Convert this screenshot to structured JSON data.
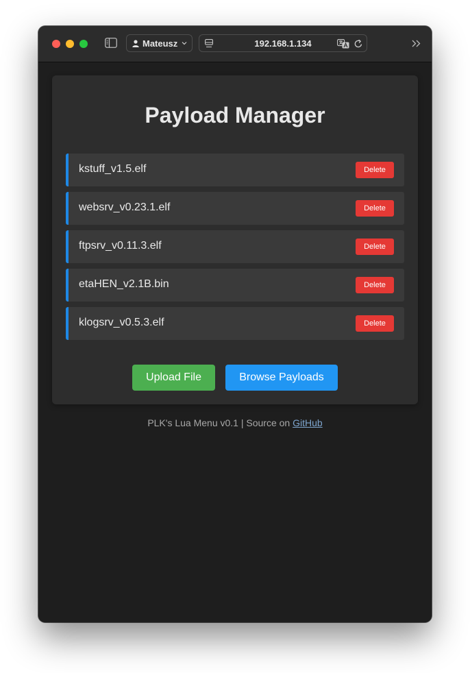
{
  "browser": {
    "profile_name": "Mateusz",
    "url": "192.168.1.134",
    "icons": [
      "sidebar-icon",
      "person-icon",
      "chevron-down-icon",
      "page-icon",
      "translate-icon",
      "reload-icon",
      "chevron-double-right-icon"
    ]
  },
  "page": {
    "title": "Payload Manager",
    "payloads": [
      {
        "name": "kstuff_v1.5.elf",
        "delete_label": "Delete"
      },
      {
        "name": "websrv_v0.23.1.elf",
        "delete_label": "Delete"
      },
      {
        "name": "ftpsrv_v0.11.3.elf",
        "delete_label": "Delete"
      },
      {
        "name": "etaHEN_v2.1B.bin",
        "delete_label": "Delete"
      },
      {
        "name": "klogsrv_v0.5.3.elf",
        "delete_label": "Delete"
      }
    ],
    "upload_label": "Upload File",
    "browse_label": "Browse Payloads",
    "footer": {
      "prefix": "PLK's Lua Menu v0.1 | Source on ",
      "link_text": "GitHub"
    }
  },
  "colors": {
    "accent_blue": "#1e88e5",
    "delete_red": "#e53935",
    "upload_green": "#4caf50",
    "browse_blue": "#2196f3"
  }
}
